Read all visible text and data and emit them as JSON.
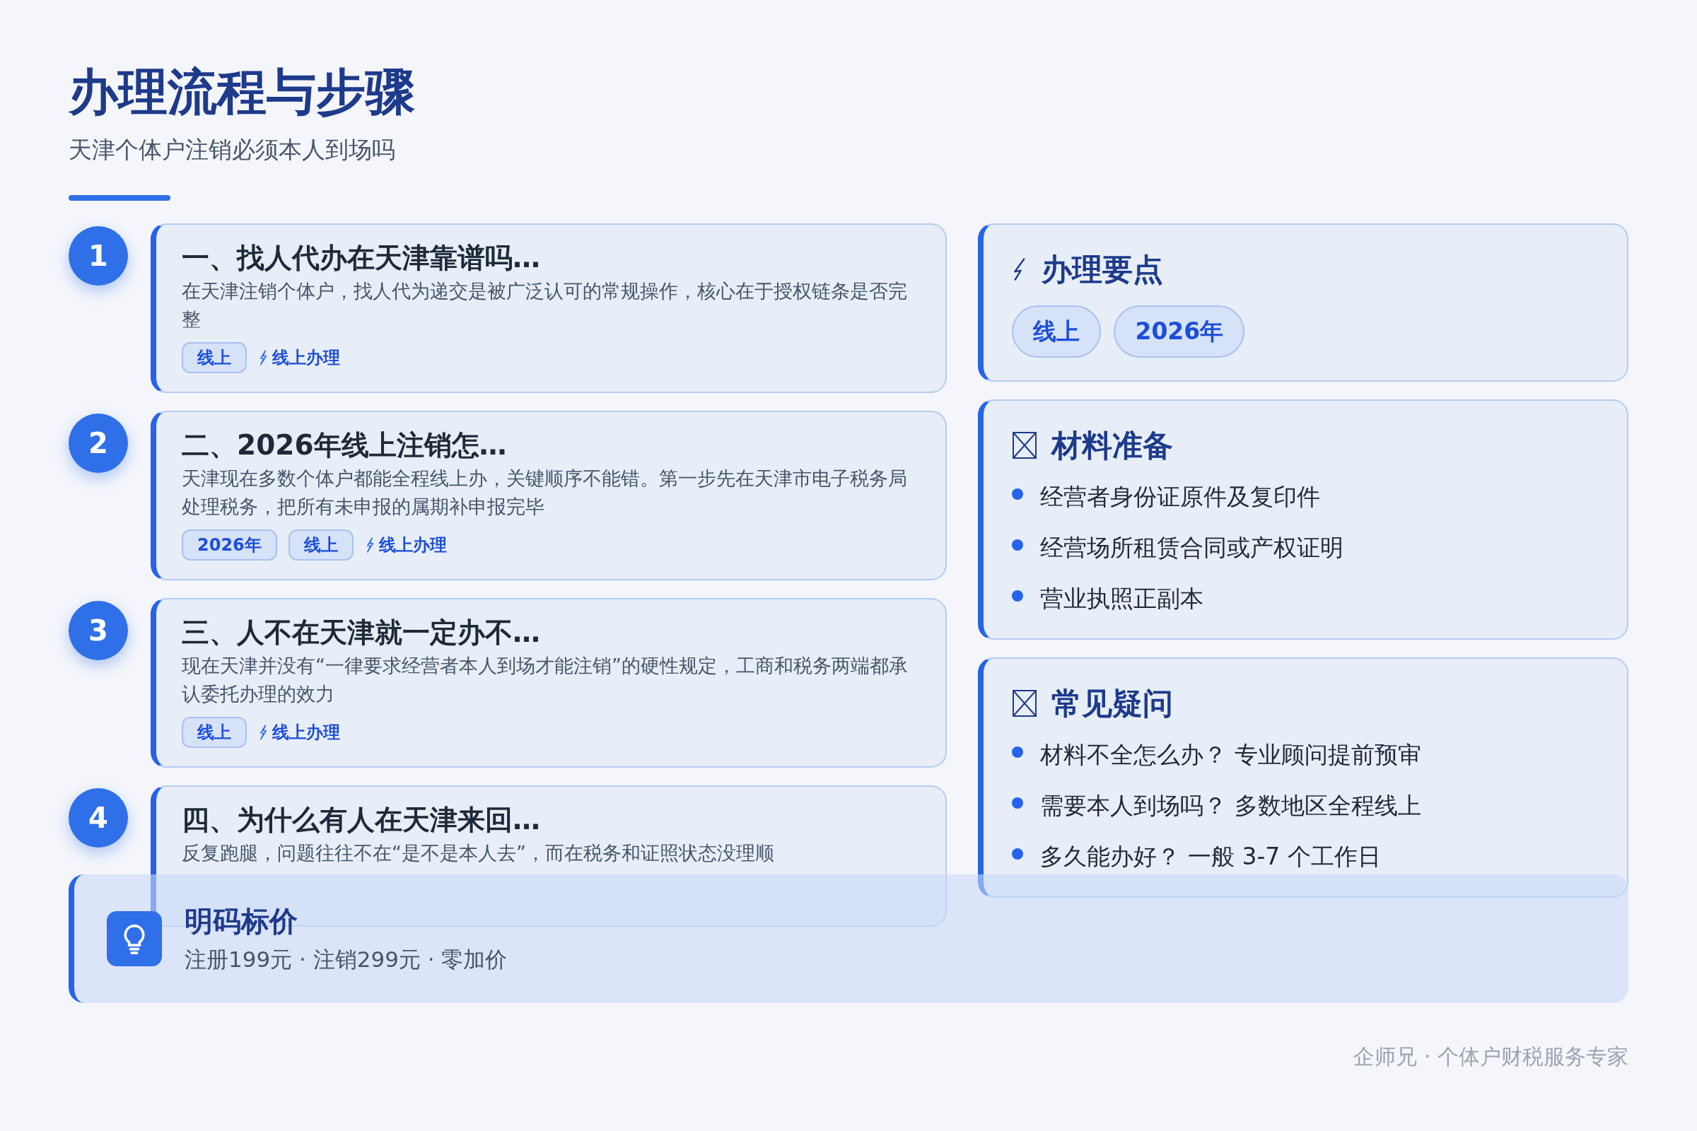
{
  "header": {
    "title": "办理流程与步骤",
    "subtitle": "天津个体户注销必须本人到场吗"
  },
  "steps": [
    {
      "number": "1",
      "title": "一、找人代办在天津靠谱吗…",
      "description": "在天津注销个体户，找人代为递交是被广泛认可的常规操作，核心在于授权链条是否完整",
      "tags": [
        "线上"
      ],
      "link": "线上办理"
    },
    {
      "number": "2",
      "title": "二、2026年线上注销怎…",
      "description": "天津现在多数个体户都能全程线上办，关键顺序不能错。第一步先在天津市电子税务局处理税务，把所有未申报的属期补申报完毕",
      "tags": [
        "2026年",
        "线上"
      ],
      "link": "线上办理"
    },
    {
      "number": "3",
      "title": "三、人不在天津就一定办不…",
      "description": "现在天津并没有“一律要求经营者本人到场才能注销”的硬性规定，工商和税务两端都承认委托办理的效力",
      "tags": [
        "线上"
      ],
      "link": "线上办理"
    },
    {
      "number": "4",
      "title": "四、为什么有人在天津来回…",
      "description": "反复跑腿，问题往往不在“是不是本人去”，而在税务和证照状态没理顺"
    }
  ],
  "key_points": {
    "title": "办理要点",
    "tags": [
      "线上",
      "2026年"
    ]
  },
  "sections": [
    {
      "title": "材料准备",
      "items": [
        "经营者身份证原件及复印件",
        "经营场所租赁合同或产权证明",
        "营业执照正副本"
      ]
    },
    {
      "title": "常见疑问",
      "items": [
        "材料不全怎么办？ 专业顾问提前预审",
        "需要本人到场吗？ 多数地区全程线上",
        "多久能办好？ 一般 3-7 个工作日"
      ]
    }
  ],
  "banner": {
    "title": "明码标价",
    "text": "注册199元 · 注销299元 · 零加价"
  },
  "footer": "企师兄 · 个体户财税服务专家"
}
